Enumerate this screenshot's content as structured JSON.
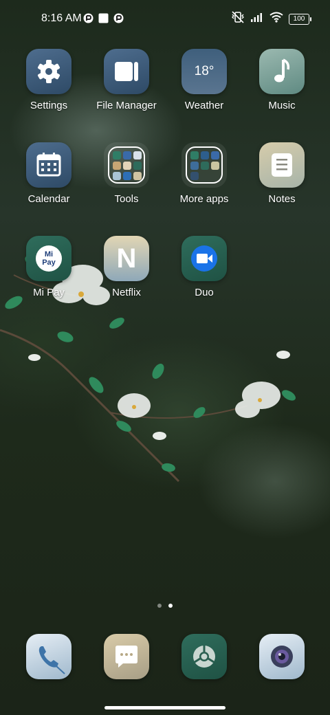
{
  "status_bar": {
    "time": "8:16 AM",
    "battery": "100",
    "icons": [
      "notification-icon",
      "square-notification-icon",
      "notification-icon-2",
      "vibrate-off-icon",
      "signal-icon",
      "wifi-icon",
      "battery-icon"
    ]
  },
  "apps": [
    {
      "name": "settings",
      "label": "Settings",
      "icon": "gear-icon"
    },
    {
      "name": "file-manager",
      "label": "File Manager",
      "icon": "folder-icon"
    },
    {
      "name": "weather",
      "label": "Weather",
      "icon_text": "18°"
    },
    {
      "name": "music",
      "label": "Music",
      "icon": "music-note-icon"
    },
    {
      "name": "calendar",
      "label": "Calendar",
      "icon": "calendar-icon"
    },
    {
      "name": "tools",
      "label": "Tools",
      "icon": "folder-grid-icon"
    },
    {
      "name": "more-apps",
      "label": "More apps",
      "icon": "folder-grid-icon"
    },
    {
      "name": "notes",
      "label": "Notes",
      "icon": "notes-icon"
    },
    {
      "name": "mi-pay",
      "label": "Mi Pay",
      "icon_text": "Mi Pay"
    },
    {
      "name": "netflix",
      "label": "Netflix",
      "icon_text": "N"
    },
    {
      "name": "duo",
      "label": "Duo",
      "icon": "video-camera-icon"
    }
  ],
  "page_indicator": {
    "pages": 2,
    "active": 2
  },
  "dock": [
    {
      "name": "phone",
      "icon": "phone-icon"
    },
    {
      "name": "messages",
      "icon": "message-icon"
    },
    {
      "name": "chrome",
      "icon": "chrome-icon"
    },
    {
      "name": "camera",
      "icon": "camera-icon"
    }
  ],
  "colors": {
    "accent": "#3b5670",
    "wallpaper": "#1e2a1b"
  }
}
